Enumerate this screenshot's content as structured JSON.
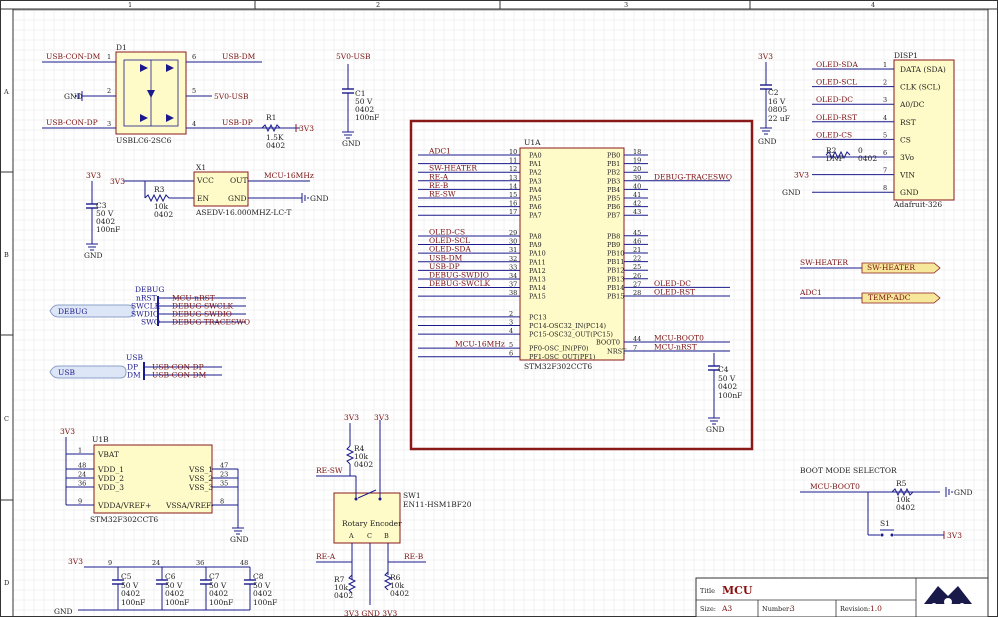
{
  "frame": {
    "columns": [
      "1",
      "2",
      "3",
      "4"
    ],
    "rows": [
      "A",
      "B",
      "C",
      "D"
    ]
  },
  "title_block": {
    "title_label": "Title",
    "title": "MCU",
    "size_label": "Size:",
    "size": "A3",
    "number_label": "Number:",
    "number": "3",
    "revision_label": "Revision:",
    "revision": "1.0"
  },
  "d1": {
    "ref": "D1",
    "part": "USBLC6-2SC6",
    "pins": [
      "1",
      "6",
      "2",
      "5",
      "3",
      "4"
    ],
    "nets": [
      "USB-CON-DM",
      "USB-DM",
      "GND",
      "5V0-USB",
      "USB-CON-DP",
      "USB-DP"
    ]
  },
  "r1": {
    "ref": "R1",
    "value": "1.5K",
    "pkg": "0402",
    "net": "3V3"
  },
  "c1": {
    "ref": "C1",
    "rail": "5V0-USB",
    "voltage": "50 V",
    "pkg": "0402",
    "value": "100nF",
    "gnd": "GND"
  },
  "c2": {
    "ref": "C2",
    "rail": "3V3",
    "voltage": "16 V",
    "pkg": "0805",
    "value": "22 uF",
    "gnd": "GND"
  },
  "x1": {
    "ref": "X1",
    "part": "ASEDV-16.000MHZ-LC-T",
    "pins": [
      "VCC",
      "OUT",
      "EN",
      "GND"
    ],
    "out_net": "MCU-16MHz",
    "rail": "3V3",
    "gnd": "GND"
  },
  "r3": {
    "ref": "R3",
    "value": "10k",
    "pkg": "0402"
  },
  "c3": {
    "ref": "C3",
    "rail": "3V3",
    "voltage": "50 V",
    "pkg": "0402",
    "value": "100nF",
    "gnd": "GND"
  },
  "disp1": {
    "ref": "DISP1",
    "part": "Adafruit-326",
    "pins": [
      {
        "num": "1",
        "name": "DATA (SDA)",
        "net": "OLED-SDA"
      },
      {
        "num": "2",
        "name": "CLK (SCL)",
        "net": "OLED-SCL"
      },
      {
        "num": "3",
        "name": "A0/DC",
        "net": "OLED-DC"
      },
      {
        "num": "4",
        "name": "RST",
        "net": "OLED-RST"
      },
      {
        "num": "5",
        "name": "CS",
        "net": "OLED-CS"
      },
      {
        "num": "6",
        "name": "3Vo",
        "net": ""
      },
      {
        "num": "7",
        "name": "VIN",
        "net": "3V3"
      },
      {
        "num": "8",
        "name": "GND",
        "net": "GND"
      }
    ]
  },
  "r2": {
    "ref": "R2",
    "value": "0",
    "pkg": "0402",
    "note": "DNP"
  },
  "u1a": {
    "ref": "U1A",
    "part": "STM32F302CCT6",
    "left_pins": [
      {
        "num": "10",
        "name": "PA0",
        "net": "ADC1"
      },
      {
        "num": "11",
        "name": "PA1",
        "net": ""
      },
      {
        "num": "12",
        "name": "PA2",
        "net": "SW-HEATER"
      },
      {
        "num": "13",
        "name": "PA3",
        "net": "RE-A"
      },
      {
        "num": "14",
        "name": "PA4",
        "net": "RE-B"
      },
      {
        "num": "15",
        "name": "PA5",
        "net": "RE-SW"
      },
      {
        "num": "16",
        "name": "PA6",
        "net": ""
      },
      {
        "num": "17",
        "name": "PA7",
        "net": ""
      },
      {
        "num": "29",
        "name": "PA8",
        "net": "OLED-CS"
      },
      {
        "num": "30",
        "name": "PA9",
        "net": "OLED-SCL"
      },
      {
        "num": "31",
        "name": "PA10",
        "net": "OLED-SDA"
      },
      {
        "num": "32",
        "name": "PA11",
        "net": "USB-DM"
      },
      {
        "num": "33",
        "name": "PA12",
        "net": "USB-DP"
      },
      {
        "num": "34",
        "name": "PA13",
        "net": "DEBUG-SWDIO"
      },
      {
        "num": "37",
        "name": "PA14",
        "net": "DEBUG-SWCLK"
      },
      {
        "num": "38",
        "name": "PA15",
        "net": ""
      },
      {
        "num": "2",
        "name": "PC13",
        "net": ""
      },
      {
        "num": "3",
        "name": "PC14-OSC32_IN(PC14)",
        "net": ""
      },
      {
        "num": "4",
        "name": "PC15-OSC32_OUT(PC15)",
        "net": ""
      },
      {
        "num": "5",
        "name": "PF0-OSC_IN(PF0)",
        "net": "MCU-16MHz"
      },
      {
        "num": "6",
        "name": "PF1-OSC_OUT(PF1)",
        "net": ""
      }
    ],
    "right_pins": [
      {
        "num": "18",
        "name": "PB0",
        "net": ""
      },
      {
        "num": "19",
        "name": "PB1",
        "net": ""
      },
      {
        "num": "20",
        "name": "PB2",
        "net": ""
      },
      {
        "num": "39",
        "name": "PB3",
        "net": "DEBUG-TRACESWO"
      },
      {
        "num": "40",
        "name": "PB4",
        "net": ""
      },
      {
        "num": "41",
        "name": "PB5",
        "net": ""
      },
      {
        "num": "42",
        "name": "PB6",
        "net": ""
      },
      {
        "num": "43",
        "name": "PB7",
        "net": ""
      },
      {
        "num": "45",
        "name": "PB8",
        "net": ""
      },
      {
        "num": "46",
        "name": "PB9",
        "net": ""
      },
      {
        "num": "21",
        "name": "PB10",
        "net": ""
      },
      {
        "num": "22",
        "name": "PB11",
        "net": ""
      },
      {
        "num": "25",
        "name": "PB12",
        "net": ""
      },
      {
        "num": "26",
        "name": "PB13",
        "net": ""
      },
      {
        "num": "27",
        "name": "PB14",
        "net": "OLED-DC"
      },
      {
        "num": "28",
        "name": "PB15",
        "net": "OLED-RST"
      },
      {
        "num": "44",
        "name": "BOOT0",
        "net": "MCU-BOOT0"
      },
      {
        "num": "7",
        "name": "NRST",
        "net": "MCU-nRST"
      }
    ]
  },
  "c4": {
    "ref": "C4",
    "voltage": "50 V",
    "pkg": "0402",
    "value": "100nF",
    "gnd": "GND"
  },
  "ports": {
    "sw_heater": {
      "net": "SW-HEATER",
      "label": "SW-HEATER"
    },
    "adc1": {
      "net": "ADC1",
      "label": "TEMP-ADC"
    }
  },
  "debug_bus": {
    "name": "DEBUG",
    "header": "DEBUG",
    "entries": [
      {
        "sig": "nRST",
        "net": "MCU-nRST"
      },
      {
        "sig": "SWCLK",
        "net": "DEBUG-SWCLK"
      },
      {
        "sig": "SWDIO",
        "net": "DEBUG-SWDIO"
      },
      {
        "sig": "SWO",
        "net": "DEBUG-TRACESWO"
      }
    ]
  },
  "usb_bus": {
    "name": "USB",
    "header": "USB",
    "entries": [
      {
        "sig": "DP",
        "net": "USB-CON-DP"
      },
      {
        "sig": "DM",
        "net": "USB-CON-DM"
      }
    ]
  },
  "u1b": {
    "ref": "U1B",
    "part": "STM32F302CCT6",
    "rail": "3V3",
    "gnd": "GND",
    "left_pins": [
      {
        "num": "1",
        "name": "VBAT"
      },
      {
        "num": "48",
        "name": "VDD_1"
      },
      {
        "num": "24",
        "name": "VDD_2"
      },
      {
        "num": "36",
        "name": "VDD_3"
      },
      {
        "num": "9",
        "name": "VDDA/VREF+"
      }
    ],
    "right_pins": [
      {
        "num": "47",
        "name": "VSS_1"
      },
      {
        "num": "23",
        "name": "VSS_2"
      },
      {
        "num": "35",
        "name": "VSS_3"
      },
      {
        "num": "8",
        "name": "VSSA/VREF-"
      }
    ]
  },
  "sw1": {
    "ref": "SW1",
    "part": "EN11-HSM1BF20",
    "label": "Rotary Encoder",
    "pins": [
      "A",
      "C",
      "B"
    ],
    "sw_net": "RE-SW",
    "a_net": "RE-A",
    "b_net": "RE-B",
    "rail": "3V3",
    "gnd": "GND"
  },
  "r4": {
    "ref": "R4",
    "value": "10k",
    "pkg": "0402",
    "rail": "3V3"
  },
  "r6": {
    "ref": "R6",
    "value": "10k",
    "pkg": "0402"
  },
  "r7": {
    "ref": "R7",
    "value": "10k",
    "pkg": "0402"
  },
  "bottom_rails": {
    "rail": "3V3",
    "gnd": "GND",
    "gnd_clipped": "3V3 GND 3V3"
  },
  "decoupling": [
    {
      "ref": "C5",
      "pin": "9",
      "voltage": "50 V",
      "pkg": "0402",
      "value": "100nF"
    },
    {
      "ref": "C6",
      "pin": "24",
      "voltage": "50 V",
      "pkg": "0402",
      "value": "100nF"
    },
    {
      "ref": "C7",
      "pin": "36",
      "voltage": "50 V",
      "pkg": "0402",
      "value": "100nF"
    },
    {
      "ref": "C8",
      "pin": "48",
      "voltage": "50 V",
      "pkg": "0402",
      "value": "100nF"
    }
  ],
  "boot": {
    "heading": "BOOT MODE SELECTOR",
    "net": "MCU-BOOT0",
    "r5": {
      "ref": "R5",
      "value": "10k",
      "pkg": "0402",
      "gnd": "GND"
    },
    "s1": {
      "ref": "S1",
      "rail": "3V3"
    }
  },
  "colors": {
    "wire": "#1a1a8c",
    "part_fill": "#fffbc8",
    "part_stroke": "#8a1a1a",
    "net_label": "#7a1010",
    "mcu_frame": "#8a1a1a"
  }
}
